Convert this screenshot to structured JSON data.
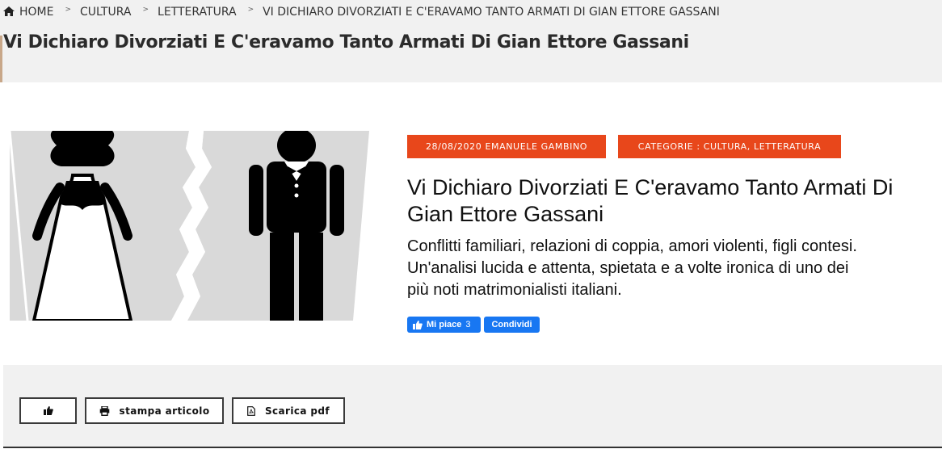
{
  "breadcrumb": {
    "home": "HOME",
    "items": [
      "CULTURA",
      "LETTERATURA",
      "VI DICHIARO DIVORZIATI E C'ERAVAMO TANTO ARMATI DI GIAN ETTORE GASSANI"
    ],
    "separator": ">"
  },
  "page": {
    "title": "Vi Dichiaro Divorziati E C'eravamo Tanto Armati Di Gian Ettore Gassani"
  },
  "article": {
    "date_author": "28/08/2020 EMANUELE GAMBINO",
    "categories": "CATEGORIE : CULTURA, LETTERATURA",
    "title": "Vi Dichiaro Divorziati E C'eravamo Tanto Armati Di Gian Ettore Gassani",
    "description_lines": [
      "Conflitti familiari, relazioni di coppia, amori violenti, figli contesi.",
      "Un'analisi lucida e attenta, spietata e a volte ironica di uno dei",
      "più noti matrimonialisti italiani."
    ]
  },
  "facebook": {
    "like_label": "Mi piace",
    "like_count": "3",
    "share_label": "Condividi"
  },
  "actions": {
    "print_label": "stampa articolo",
    "pdf_label": "Scarica pdf"
  },
  "icons": {
    "home": "home-icon",
    "like": "thumbs-up-icon",
    "print": "printer-icon",
    "pdf": "pdf-file-icon"
  },
  "colors": {
    "accent": "#e8471b",
    "facebook": "#1877f2",
    "band": "#f1f1f1"
  }
}
